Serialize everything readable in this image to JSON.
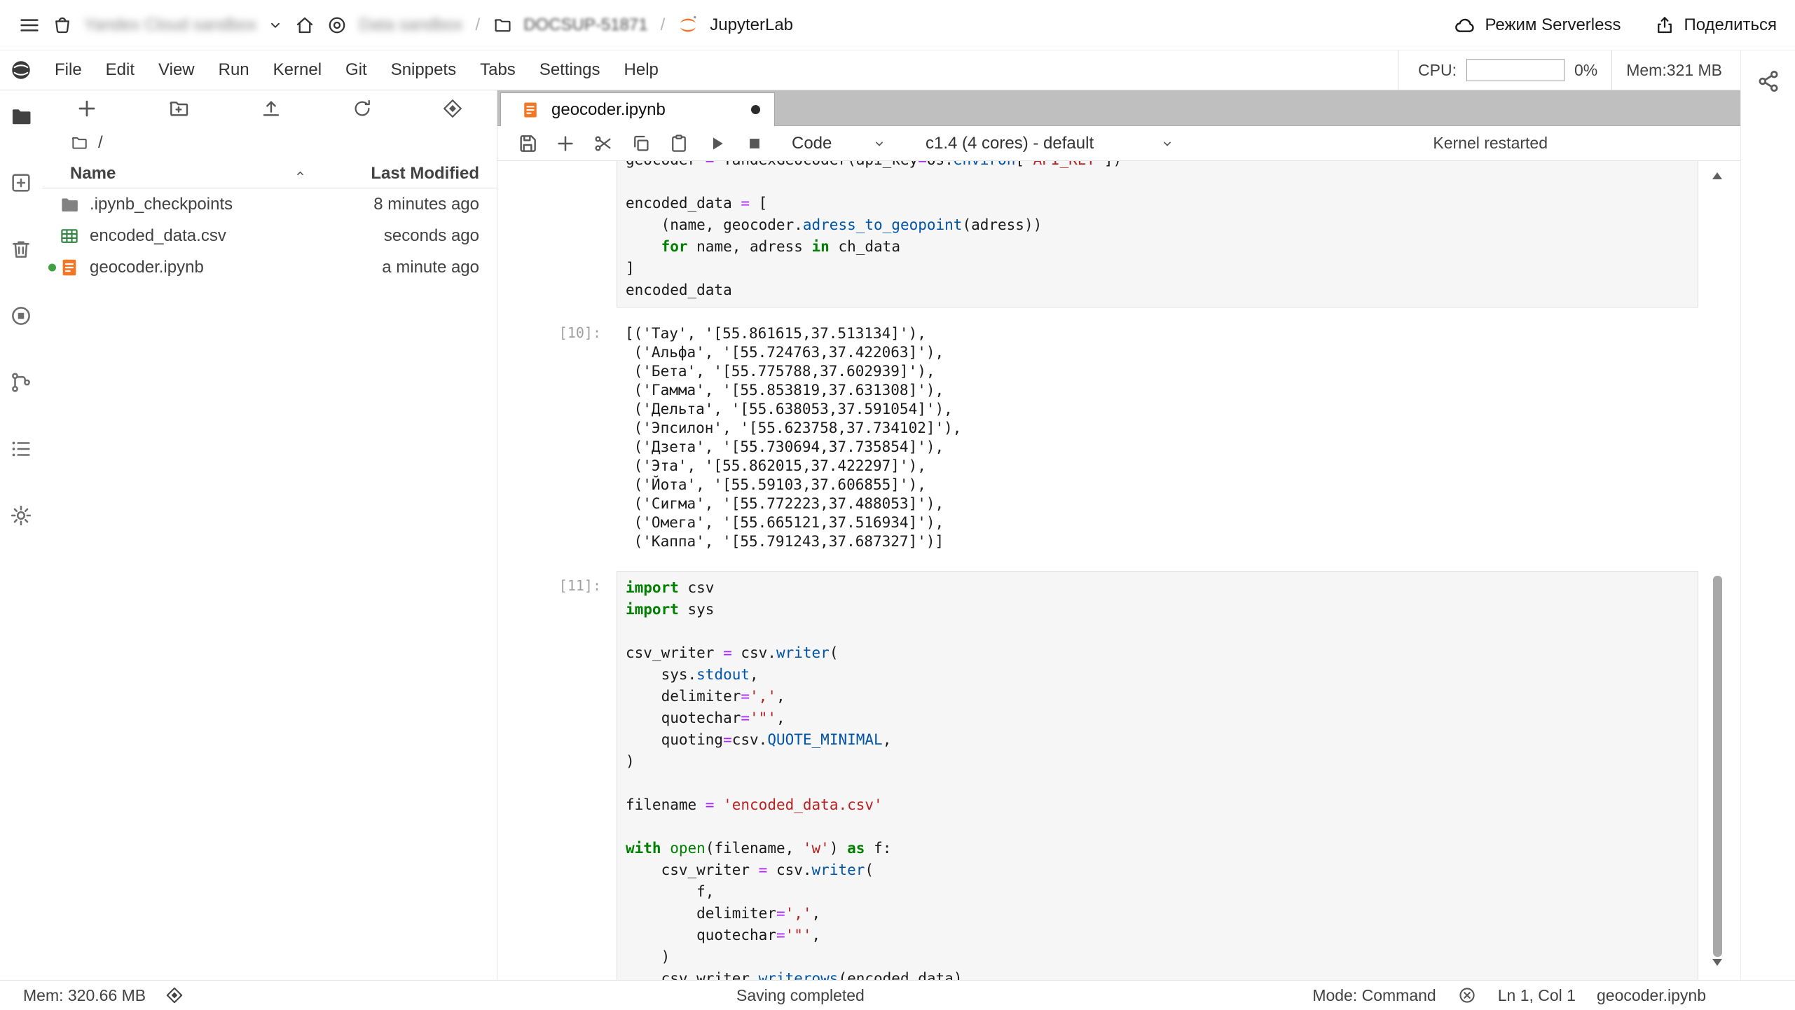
{
  "topbar": {
    "org": "Yandex Cloud sandbox",
    "project": "Data sandbox",
    "folder": "DOCSUP-51871",
    "slash": "/",
    "app": "JupyterLab",
    "serverless": "Режим Serverless",
    "share": "Поделиться"
  },
  "menubar": {
    "items": [
      "File",
      "Edit",
      "View",
      "Run",
      "Kernel",
      "Git",
      "Snippets",
      "Tabs",
      "Settings",
      "Help"
    ],
    "cpu_label": "CPU:",
    "cpu_value": "0%",
    "mem_value": "Mem:321 MB"
  },
  "filebrowser": {
    "root": "/",
    "name_col": "Name",
    "modified_col": "Last Modified",
    "files": [
      {
        "name": ".ipynb_checkpoints",
        "modified": "8 minutes ago",
        "icon": "folder",
        "running": false
      },
      {
        "name": "encoded_data.csv",
        "modified": "seconds ago",
        "icon": "csv",
        "running": false
      },
      {
        "name": "geocoder.ipynb",
        "modified": "a minute ago",
        "icon": "notebook",
        "running": true
      }
    ]
  },
  "tab": {
    "label": "geocoder.ipynb"
  },
  "toolbar": {
    "cell_type": "Code",
    "kernel": "c1.4 (4 cores) - default",
    "message": "Kernel restarted"
  },
  "notebook": {
    "cells": [
      {
        "type": "code",
        "prompt": "",
        "clipped": true,
        "lines": [
          [
            [
              "",
              "geocoder "
            ],
            [
              "o",
              "="
            ],
            [
              "",
              " YandexGeocoder(api_key"
            ],
            [
              "o",
              "="
            ],
            [
              "",
              "os."
            ],
            [
              "pr",
              "environ"
            ],
            [
              "",
              "["
            ],
            [
              "s",
              "'API_KEY'"
            ],
            [
              "",
              "])"
            ]
          ],
          [],
          [
            [
              "",
              "encoded_data "
            ],
            [
              "o",
              "="
            ],
            [
              "",
              " ["
            ]
          ],
          [
            [
              "",
              "    (name, geocoder."
            ],
            [
              "pr",
              "adress_to_geopoint"
            ],
            [
              "",
              "(adress))"
            ]
          ],
          [
            [
              "",
              "    "
            ],
            [
              "k",
              "for"
            ],
            [
              "",
              " name, adress "
            ],
            [
              "k",
              "in"
            ],
            [
              "",
              " ch_data"
            ]
          ],
          [
            [
              "",
              "]"
            ]
          ],
          [
            [
              "",
              "encoded_data"
            ]
          ]
        ]
      },
      {
        "type": "output",
        "prompt": "[10]:",
        "lines": [
          "[('Тау', '[55.861615,37.513134]'),",
          " ('Альфа', '[55.724763,37.422063]'),",
          " ('Бета', '[55.775788,37.602939]'),",
          " ('Гамма', '[55.853819,37.631308]'),",
          " ('Дельта', '[55.638053,37.591054]'),",
          " ('Эпсилон', '[55.623758,37.734102]'),",
          " ('Дзета', '[55.730694,37.735854]'),",
          " ('Эта', '[55.862015,37.422297]'),",
          " ('Йота', '[55.59103,37.606855]'),",
          " ('Сигма', '[55.772223,37.488053]'),",
          " ('Омега', '[55.665121,37.516934]'),",
          " ('Каппа', '[55.791243,37.687327]')]"
        ]
      },
      {
        "type": "code",
        "prompt": "[11]:",
        "lines": [
          [
            [
              "k",
              "import"
            ],
            [
              "",
              " csv"
            ]
          ],
          [
            [
              "k",
              "import"
            ],
            [
              "",
              " sys"
            ]
          ],
          [],
          [
            [
              "",
              "csv_writer "
            ],
            [
              "o",
              "="
            ],
            [
              "",
              " csv."
            ],
            [
              "pr",
              "writer"
            ],
            [
              "",
              "("
            ]
          ],
          [
            [
              "",
              "    sys."
            ],
            [
              "pr",
              "stdout"
            ],
            [
              "",
              ","
            ]
          ],
          [
            [
              "",
              "    delimiter"
            ],
            [
              "o",
              "="
            ],
            [
              "s",
              "','"
            ],
            [
              "",
              ","
            ]
          ],
          [
            [
              "",
              "    quotechar"
            ],
            [
              "o",
              "="
            ],
            [
              "s",
              "'\"'"
            ],
            [
              "",
              ","
            ]
          ],
          [
            [
              "",
              "    quoting"
            ],
            [
              "o",
              "="
            ],
            [
              "",
              "csv."
            ],
            [
              "pr",
              "QUOTE_MINIMAL"
            ],
            [
              "",
              ","
            ]
          ],
          [
            [
              "",
              ")"
            ]
          ],
          [],
          [
            [
              "",
              "filename "
            ],
            [
              "o",
              "="
            ],
            [
              "",
              " "
            ],
            [
              "s",
              "'encoded_data.csv'"
            ]
          ],
          [],
          [
            [
              "k",
              "with"
            ],
            [
              "",
              " "
            ],
            [
              "b",
              "open"
            ],
            [
              "",
              "(filename, "
            ],
            [
              "s",
              "'w'"
            ],
            [
              "",
              ") "
            ],
            [
              "k",
              "as"
            ],
            [
              "",
              " f:"
            ]
          ],
          [
            [
              "",
              "    csv_writer "
            ],
            [
              "o",
              "="
            ],
            [
              "",
              " csv."
            ],
            [
              "pr",
              "writer"
            ],
            [
              "",
              "("
            ]
          ],
          [
            [
              "",
              "        f,"
            ]
          ],
          [
            [
              "",
              "        delimiter"
            ],
            [
              "o",
              "="
            ],
            [
              "s",
              "','"
            ],
            [
              "",
              ","
            ]
          ],
          [
            [
              "",
              "        quotechar"
            ],
            [
              "o",
              "="
            ],
            [
              "s",
              "'\"'"
            ],
            [
              "",
              ","
            ]
          ],
          [
            [
              "",
              "    )"
            ]
          ],
          [
            [
              "",
              "    csv_writer."
            ],
            [
              "pr",
              "writerows"
            ],
            [
              "",
              "(encoded_data)"
            ]
          ]
        ]
      }
    ]
  },
  "statusbar": {
    "mem": "Mem: 320.66 MB",
    "message": "Saving completed",
    "mode": "Mode: Command",
    "position": "Ln 1, Col 1",
    "file": "geocoder.ipynb"
  }
}
